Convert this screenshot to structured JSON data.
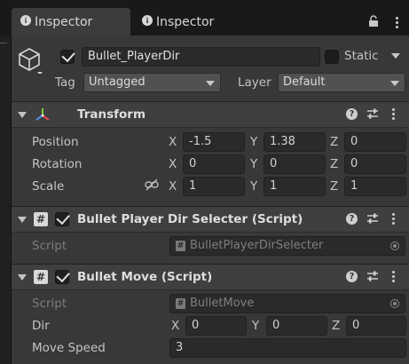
{
  "tabs": [
    {
      "label": "Inspector",
      "icon": "info-icon",
      "active": true
    },
    {
      "label": "Inspector",
      "icon": "info-icon",
      "active": false
    }
  ],
  "tab_actions": {
    "lock_icon": "lock-icon",
    "menu_icon": "kebab-menu-icon"
  },
  "object": {
    "icon": "cube-icon",
    "active": true,
    "name": "Bullet_PlayerDir",
    "static_label": "Static",
    "static_checked": false,
    "tag_label": "Tag",
    "tag_value": "Untagged",
    "layer_label": "Layer",
    "layer_value": "Default"
  },
  "transform": {
    "title": "Transform",
    "icon": "transform-axes-icon",
    "rows": [
      {
        "label": "Position",
        "x": "-1.5",
        "y": "1.38",
        "z": "0"
      },
      {
        "label": "Rotation",
        "x": "0",
        "y": "0",
        "z": "0"
      },
      {
        "label": "Scale",
        "x": "1",
        "y": "1",
        "z": "1",
        "link_icon": "constrain-proportions-icon"
      }
    ],
    "axis_labels": {
      "x": "X",
      "y": "Y",
      "z": "Z"
    }
  },
  "component1": {
    "title": "Bullet Player Dir Selecter (Script)",
    "enabled": true,
    "script_label": "Script",
    "script_value": "BulletPlayerDirSelecter"
  },
  "component2": {
    "title": "Bullet Move (Script)",
    "enabled": true,
    "script_label": "Script",
    "script_value": "BulletMove",
    "dir_label": "Dir",
    "dir": {
      "x": "0",
      "y": "0",
      "z": "0"
    },
    "move_speed_label": "Move Speed",
    "move_speed": "3"
  },
  "colors": {
    "panel": "#383838",
    "header": "#3f3f3f",
    "field": "#2a2a2a",
    "tabbar": "#191919",
    "active_tab": "#3c3c3c"
  }
}
